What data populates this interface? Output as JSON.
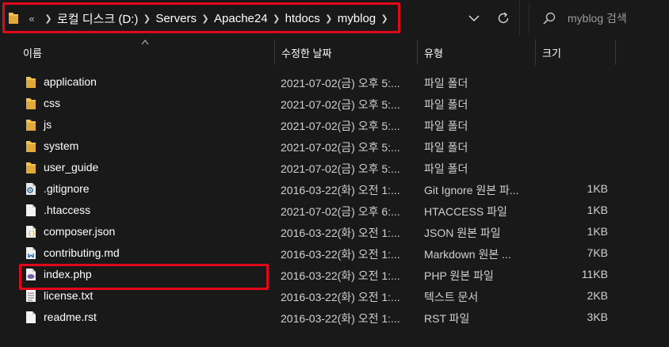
{
  "address": {
    "overflow_glyph": "«",
    "crumbs": [
      "로컬 디스크 (D:)",
      "Servers",
      "Apache24",
      "htdocs",
      "myblog"
    ]
  },
  "search": {
    "placeholder": "myblog 검색"
  },
  "columns": {
    "name": "이름",
    "date": "수정한 날짜",
    "type": "유형",
    "size": "크기"
  },
  "files": [
    {
      "name": "application",
      "date": "2021-07-02(금) 오후 5:...",
      "type": "파일 폴더",
      "size": "",
      "icon": "folder-icon"
    },
    {
      "name": "css",
      "date": "2021-07-02(금) 오후 5:...",
      "type": "파일 폴더",
      "size": "",
      "icon": "folder-icon"
    },
    {
      "name": "js",
      "date": "2021-07-02(금) 오후 5:...",
      "type": "파일 폴더",
      "size": "",
      "icon": "folder-icon"
    },
    {
      "name": "system",
      "date": "2021-07-02(금) 오후 5:...",
      "type": "파일 폴더",
      "size": "",
      "icon": "folder-icon"
    },
    {
      "name": "user_guide",
      "date": "2021-07-02(금) 오후 5:...",
      "type": "파일 폴더",
      "size": "",
      "icon": "folder-icon"
    },
    {
      "name": ".gitignore",
      "date": "2016-03-22(화) 오전 1:...",
      "type": "Git Ignore 원본 파...",
      "size": "1KB",
      "icon": "gear-file-icon"
    },
    {
      "name": ".htaccess",
      "date": "2021-07-02(금) 오후 6:...",
      "type": "HTACCESS 파일",
      "size": "1KB",
      "icon": "blank-file-icon"
    },
    {
      "name": "composer.json",
      "date": "2016-03-22(화) 오전 1:...",
      "type": "JSON 원본 파일",
      "size": "1KB",
      "icon": "json-file-icon"
    },
    {
      "name": "contributing.md",
      "date": "2016-03-22(화) 오전 1:...",
      "type": "Markdown 원본 ...",
      "size": "7KB",
      "icon": "markdown-file-icon"
    },
    {
      "name": "index.php",
      "date": "2016-03-22(화) 오전 1:...",
      "type": "PHP 원본 파일",
      "size": "11KB",
      "icon": "php-file-icon"
    },
    {
      "name": "license.txt",
      "date": "2016-03-22(화) 오전 1:...",
      "type": "텍스트 문서",
      "size": "2KB",
      "icon": "text-file-icon"
    },
    {
      "name": "readme.rst",
      "date": "2016-03-22(화) 오전 1:...",
      "type": "RST 파일",
      "size": "3KB",
      "icon": "blank-file-icon"
    }
  ],
  "colors": {
    "background": "#191919",
    "highlight_border": "#e1081c",
    "folder": "#f2c14e"
  }
}
